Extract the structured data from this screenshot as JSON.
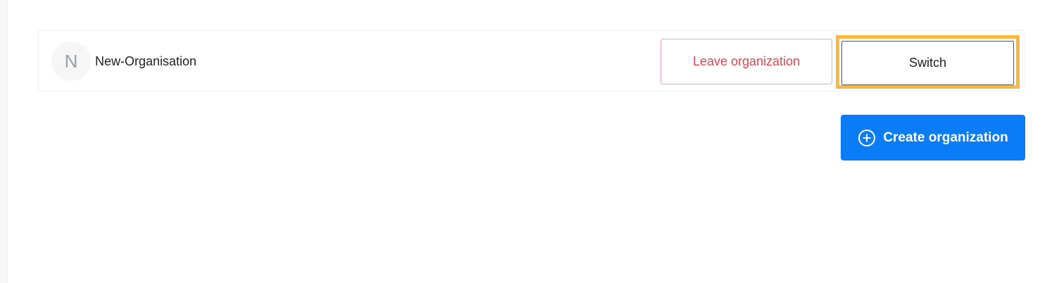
{
  "organization": {
    "avatar_initial": "N",
    "name": "New-Organisation",
    "leave_label": "Leave organization",
    "switch_label": "Switch"
  },
  "actions": {
    "create_label": "Create organization",
    "create_icon": "plus-circle-icon"
  },
  "colors": {
    "primary": "#0a7cf5",
    "danger": "#e8414f",
    "highlight": "#f5b942"
  }
}
